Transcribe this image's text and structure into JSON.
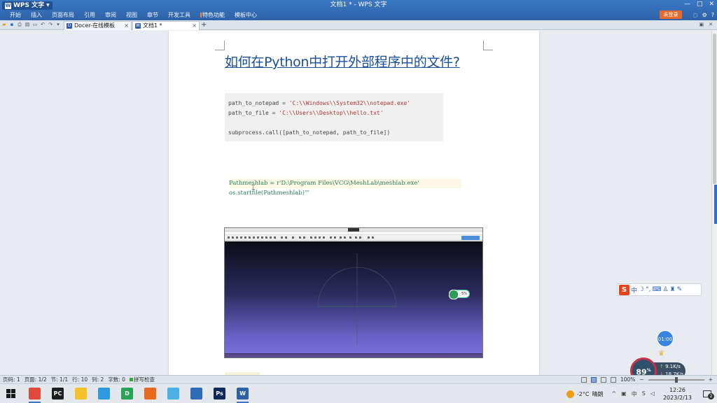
{
  "app": {
    "logo_text": "WPS 文字",
    "window_title": "文档1 * - WPS 文字"
  },
  "menu": [
    "开始",
    "插入",
    "页面布局",
    "引用",
    "审阅",
    "视图",
    "章节",
    "开发工具",
    "特色功能",
    "模板中心"
  ],
  "login_label": "未登录",
  "top_right_icons": [
    "skin-icon",
    "settings-icon",
    "help-icon"
  ],
  "window_controls": [
    "minimize-icon",
    "maximize-icon",
    "close-icon"
  ],
  "tabs": [
    {
      "label": "Docer-在线模板",
      "icon": "docer-icon",
      "active": false
    },
    {
      "label": "文档1 *",
      "icon": "word-doc-icon",
      "active": true
    }
  ],
  "document": {
    "heading": "如何在Python中打开外部程序中的文件?",
    "code1": {
      "line1_var": "path_to_notepad = ",
      "line1_str": "'C:\\\\Windows\\\\System32\\\\notepad.exe'",
      "line2_var": "path_to_file = ",
      "line2_str": "'C:\\\\Users\\\\Desktop\\\\hello.txt'",
      "line3": "subprocess.call([path_to_notepad, path_to_file])"
    },
    "code2": {
      "line1": "Pathmeshlab = r'D:\\Program Files\\VCG\\MeshLab\\meshlab.exe'",
      "line2": "os.startfile(Pathmeshlab)'''"
    },
    "embedded_image_badge": "5%"
  },
  "status": {
    "page": "页码: 1",
    "pages": "页面: 1/2",
    "section": "节: 1/1",
    "row": "行: 10",
    "col": "列: 2",
    "words": "字数: 0",
    "spell": "拼写检查",
    "zoom": "100%"
  },
  "floating": {
    "ime_logo": "S",
    "ime_mode": "中",
    "timer": "01:00",
    "speed_percent": "89",
    "upload": "9.1",
    "download": "18.7",
    "speed_unit": "K/s"
  },
  "taskbar": {
    "apps": [
      {
        "name": "chrome-icon",
        "color": "#e04a3a",
        "text": ""
      },
      {
        "name": "pycharm-icon",
        "color": "#1d1d1d",
        "text": "PC"
      },
      {
        "name": "file-explorer-icon",
        "color": "#f3c12a",
        "text": ""
      },
      {
        "name": "snipping-tool-icon",
        "color": "#2d9ae0",
        "text": ""
      },
      {
        "name": "dev-tool-icon",
        "color": "#29a35a",
        "text": "D"
      },
      {
        "name": "feishu-icon",
        "color": "#e86a1e",
        "text": ""
      },
      {
        "name": "network-icon",
        "color": "#4ab0e6",
        "text": ""
      },
      {
        "name": "photos-icon",
        "color": "#2f6bb8",
        "text": ""
      },
      {
        "name": "photoshop-icon",
        "color": "#0e2a5c",
        "text": "Ps"
      },
      {
        "name": "wps-writer-icon",
        "color": "#2e62a8",
        "text": "W"
      }
    ],
    "weather_temp": "-2°C",
    "weather_desc": "晴朗",
    "time": "12:26",
    "date": "2023/2/13",
    "notif_count": "2",
    "tray_lang": "中"
  }
}
